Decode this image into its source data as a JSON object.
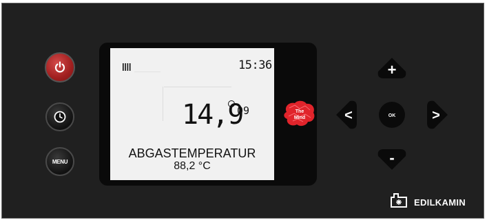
{
  "controls": {
    "power": {
      "icon": "power-icon",
      "color": "#b02424"
    },
    "clock": {
      "icon": "clock-icon"
    },
    "menu": {
      "label": "MENU"
    }
  },
  "display": {
    "heating_indicator": "bars-icon",
    "time": "15:36",
    "temperature": "14,9",
    "temperature_unit": "°",
    "sub_unit": "09",
    "parameter_name": "ABGASTEMPERATUR",
    "parameter_value": "88,2 °C"
  },
  "logo": {
    "line1": "The",
    "line2": "Mind",
    "color": "#e0242b"
  },
  "navigation": {
    "up": "+",
    "down": "-",
    "left": "<",
    "right": ">",
    "ok": "OK"
  },
  "brand": {
    "name": "EDILKAMIN"
  }
}
